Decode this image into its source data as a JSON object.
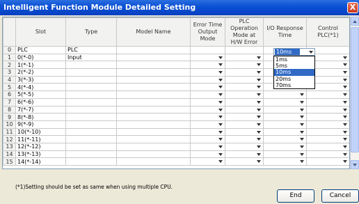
{
  "window": {
    "title": "Intelligent Function Module Detailed Setting",
    "close_label": "X"
  },
  "columns": [
    "",
    "Slot",
    "Type",
    "Model Name",
    "Error Time Output Mode",
    "PLC Operation Mode at H/W Error",
    "I/O Response Time",
    "Control PLC(*1)"
  ],
  "rows": [
    {
      "no": "0",
      "slot": "PLC",
      "type": "PLC",
      "model": ""
    },
    {
      "no": "1",
      "slot": "0(*-0)",
      "type": "Input",
      "model": ""
    },
    {
      "no": "2",
      "slot": "1(*-1)",
      "type": "",
      "model": ""
    },
    {
      "no": "3",
      "slot": "2(*-2)",
      "type": "",
      "model": ""
    },
    {
      "no": "4",
      "slot": "3(*-3)",
      "type": "",
      "model": ""
    },
    {
      "no": "5",
      "slot": "4(*-4)",
      "type": "",
      "model": ""
    },
    {
      "no": "6",
      "slot": "5(*-5)",
      "type": "",
      "model": ""
    },
    {
      "no": "7",
      "slot": "6(*-6)",
      "type": "",
      "model": ""
    },
    {
      "no": "8",
      "slot": "7(*-7)",
      "type": "",
      "model": ""
    },
    {
      "no": "9",
      "slot": "8(*-8)",
      "type": "",
      "model": ""
    },
    {
      "no": "10",
      "slot": "9(*-9)",
      "type": "",
      "model": ""
    },
    {
      "no": "11",
      "slot": "10(*-10)",
      "type": "",
      "model": ""
    },
    {
      "no": "12",
      "slot": "11(*-11)",
      "type": "",
      "model": ""
    },
    {
      "no": "13",
      "slot": "12(*-12)",
      "type": "",
      "model": ""
    },
    {
      "no": "14",
      "slot": "13(*-13)",
      "type": "",
      "model": ""
    },
    {
      "no": "15",
      "slot": "14(*-14)",
      "type": "",
      "model": ""
    }
  ],
  "io_response": {
    "selected": "10ms",
    "options": [
      "1ms",
      "5ms",
      "10ms",
      "20ms",
      "70ms"
    ],
    "highlighted_index": 2
  },
  "note": "(*1)Setting should be set as same when using multiple CPU.",
  "buttons": {
    "end": "End",
    "cancel": "Cancel"
  },
  "colors": {
    "title_bar": "#0a4fd4",
    "selection": "#316ac5",
    "dialog_bg": "#ece9d8"
  }
}
